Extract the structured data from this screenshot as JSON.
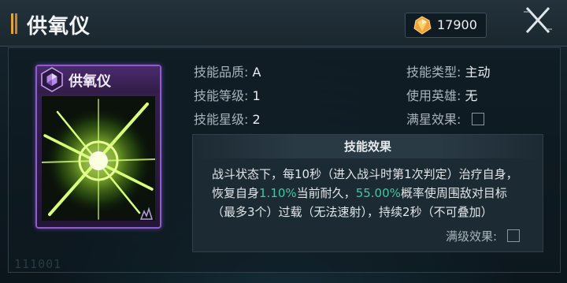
{
  "header": {
    "title": "供氧仪",
    "currency_value": "17900",
    "currency_icon": "gem-icon",
    "accent_color": "#e0a63a"
  },
  "card": {
    "name": "供氧仪",
    "frame_color": "#8e5bd1",
    "art_color": "#9be63a"
  },
  "stats": {
    "quality_label": "技能品质:",
    "quality_value": "A",
    "level_label": "技能等级:",
    "level_value": "1",
    "star_label": "技能星级:",
    "star_value": "2",
    "type_label": "技能类型:",
    "type_value": "主动",
    "hero_label": "使用英雄:",
    "hero_value": "无",
    "fullstar_label": "满星效果:"
  },
  "effect": {
    "title": "技能效果",
    "text_1": "战斗状态下，每10秒（进入战斗时第1次判定）治疗自身，恢复自身",
    "highlight_1": "1.10%",
    "text_2": "当前耐久，",
    "highlight_2": "55.00%",
    "text_3": "概率使周围敌对目标（最多3个）过载（无法速射），持续2秒（不可叠加）",
    "highlight_color": "#3fc9a2",
    "maxlevel_label": "满级效果:"
  },
  "watermark": "111001"
}
